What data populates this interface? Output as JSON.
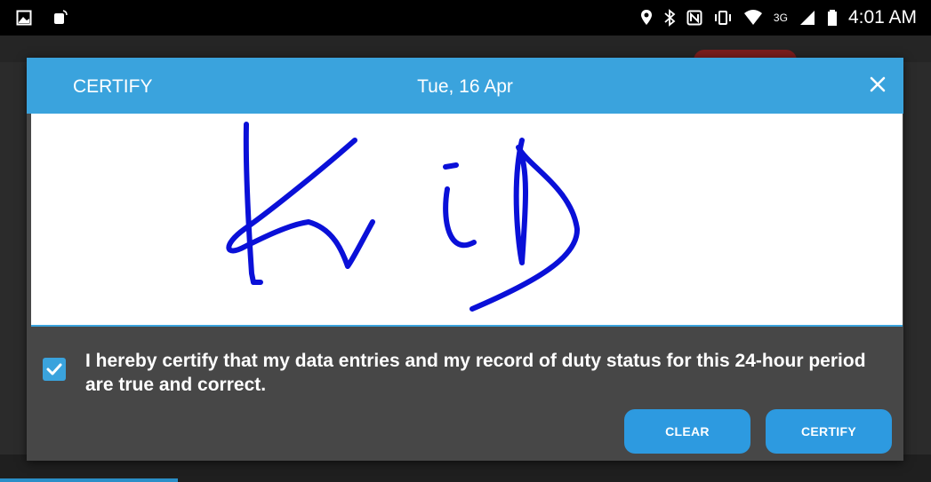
{
  "status_bar": {
    "time": "4:01 AM",
    "network": "3G",
    "left_icons": [
      "image-icon",
      "notification-icon"
    ],
    "right_icons": [
      "location-icon",
      "bluetooth-icon",
      "nfc-icon",
      "vibrate-icon",
      "wifi-icon",
      "signal-icon",
      "battery-icon"
    ]
  },
  "dialog": {
    "title": "CERTIFY",
    "date": "Tue, 16 Apr",
    "certification_checked": true,
    "certification_text": "I hereby certify that my data entries and my record of duty status for this 24-hour period are true and correct.",
    "clear_label": "CLEAR",
    "certify_label": "CERTIFY"
  },
  "colors": {
    "accent": "#3aa3dd",
    "button": "#2d9ae0",
    "dialog_bg": "#474747",
    "signature_ink": "#0a10d8"
  }
}
